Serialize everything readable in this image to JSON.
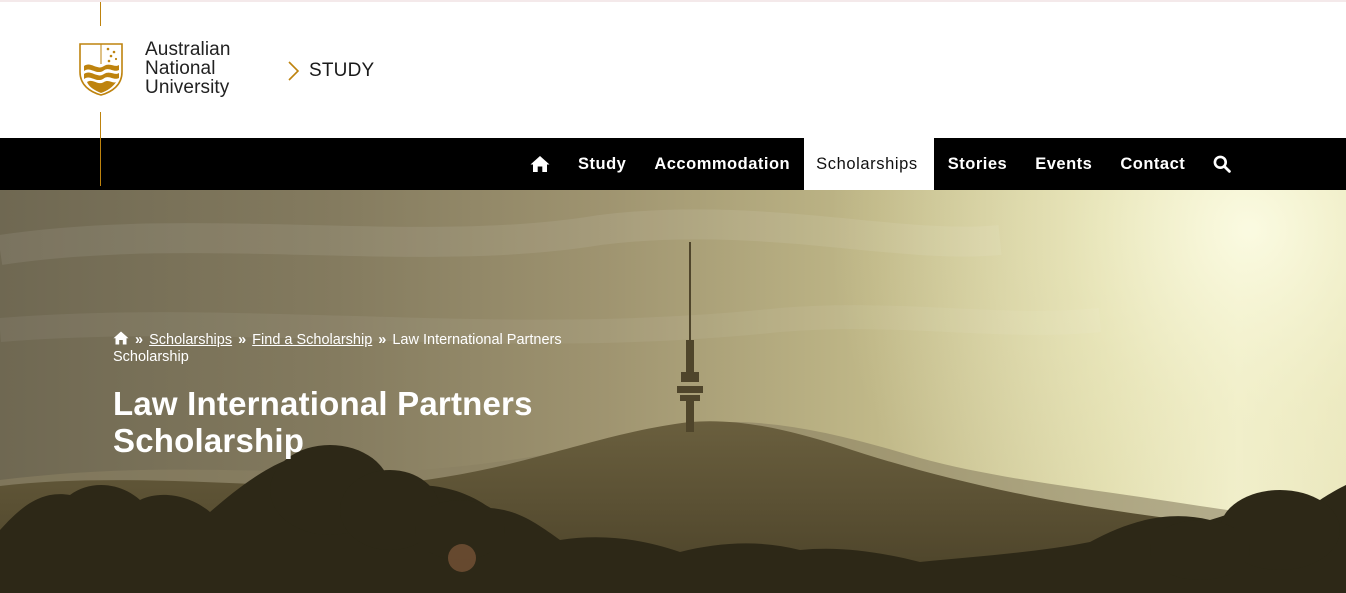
{
  "colors": {
    "gold": "#be830e",
    "nav_background": "#000000",
    "nav_active_background": "#ffffff",
    "hero_text": "#ffffff"
  },
  "header": {
    "logo": {
      "line1": "Australian",
      "line2": "National",
      "line3": "University",
      "icon": "anu-crest-icon"
    },
    "site_crumb": {
      "label": "STUDY",
      "icon": "chevron-right-icon"
    }
  },
  "nav": {
    "home_icon": "home-icon",
    "items": [
      {
        "label": "Study",
        "active": false
      },
      {
        "label": "Accommodation",
        "active": false
      },
      {
        "label": "Scholarships",
        "active": true
      },
      {
        "label": "Stories",
        "active": false
      },
      {
        "label": "Events",
        "active": false
      },
      {
        "label": "Contact",
        "active": false
      }
    ],
    "search_icon": "search-icon"
  },
  "hero": {
    "breadcrumb": {
      "home_icon": "home-icon",
      "separator": "»",
      "items": [
        {
          "label": "Scholarships",
          "link": true
        },
        {
          "label": "Find a Scholarship",
          "link": true
        },
        {
          "label": "Law International Partners Scholarship",
          "link": false
        }
      ]
    },
    "title": "Law International Partners Scholarship"
  }
}
